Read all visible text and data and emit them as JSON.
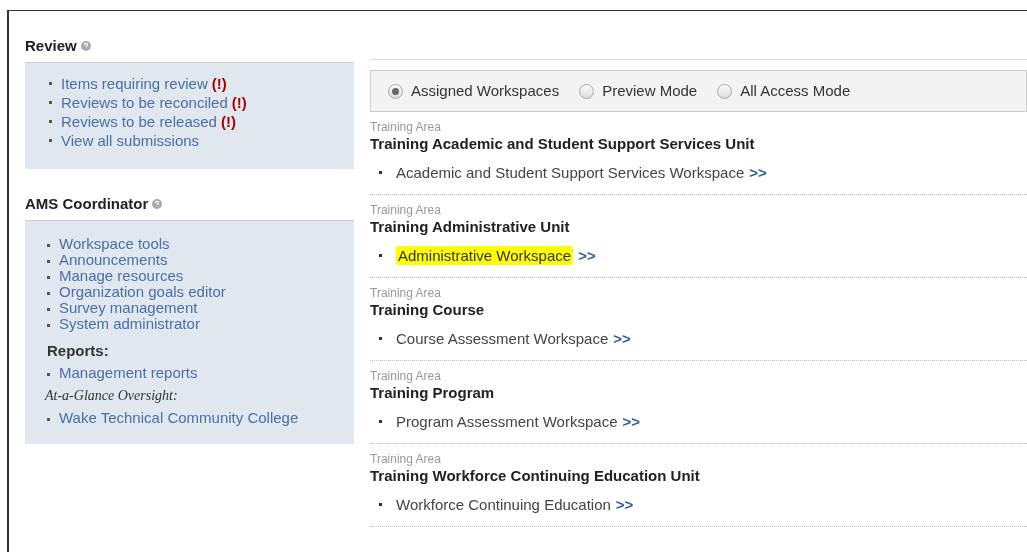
{
  "review": {
    "title": "Review",
    "items": [
      {
        "label": "Items requiring review",
        "alert": "(!)"
      },
      {
        "label": "Reviews to be reconciled",
        "alert": "(!)"
      },
      {
        "label": "Reviews to be released",
        "alert": "(!)"
      },
      {
        "label": "View all submissions"
      }
    ]
  },
  "coordinator": {
    "title": "AMS Coordinator",
    "sections": [
      {
        "items": [
          "Workspace tools",
          "Announcements",
          "Manage resources",
          "Organization goals editor",
          "Survey management",
          "System administrator"
        ]
      },
      {
        "heading": "Reports:",
        "kind": "bold",
        "items": [
          "Management reports"
        ]
      },
      {
        "heading": "At-a-Glance Oversight:",
        "kind": "italic",
        "items": [
          "Wake Technical Community College"
        ]
      }
    ]
  },
  "modes": [
    {
      "label": "Assigned Workspaces",
      "selected": true
    },
    {
      "label": "Preview Mode",
      "selected": false
    },
    {
      "label": "All Access Mode",
      "selected": false
    }
  ],
  "areas": [
    {
      "caption": "Training Area",
      "title": "Training Academic and Student Support Services Unit",
      "workspace": "Academic and Student Support Services Workspace",
      "arrow": ">>",
      "highlighted": false
    },
    {
      "caption": "Training Area",
      "title": "Training Administrative Unit",
      "workspace": "Administrative Workspace",
      "arrow": ">>",
      "highlighted": true
    },
    {
      "caption": "Training Area",
      "title": "Training Course",
      "workspace": "Course Assessment Workspace",
      "arrow": ">>",
      "highlighted": false
    },
    {
      "caption": "Training Area",
      "title": "Training Program",
      "workspace": "Program Assessment Workspace",
      "arrow": ">>",
      "highlighted": false
    },
    {
      "caption": "Training Area",
      "title": "Training Workforce Continuing Education Unit",
      "workspace": "Workforce Continuing Education",
      "arrow": ">>",
      "highlighted": false
    }
  ]
}
